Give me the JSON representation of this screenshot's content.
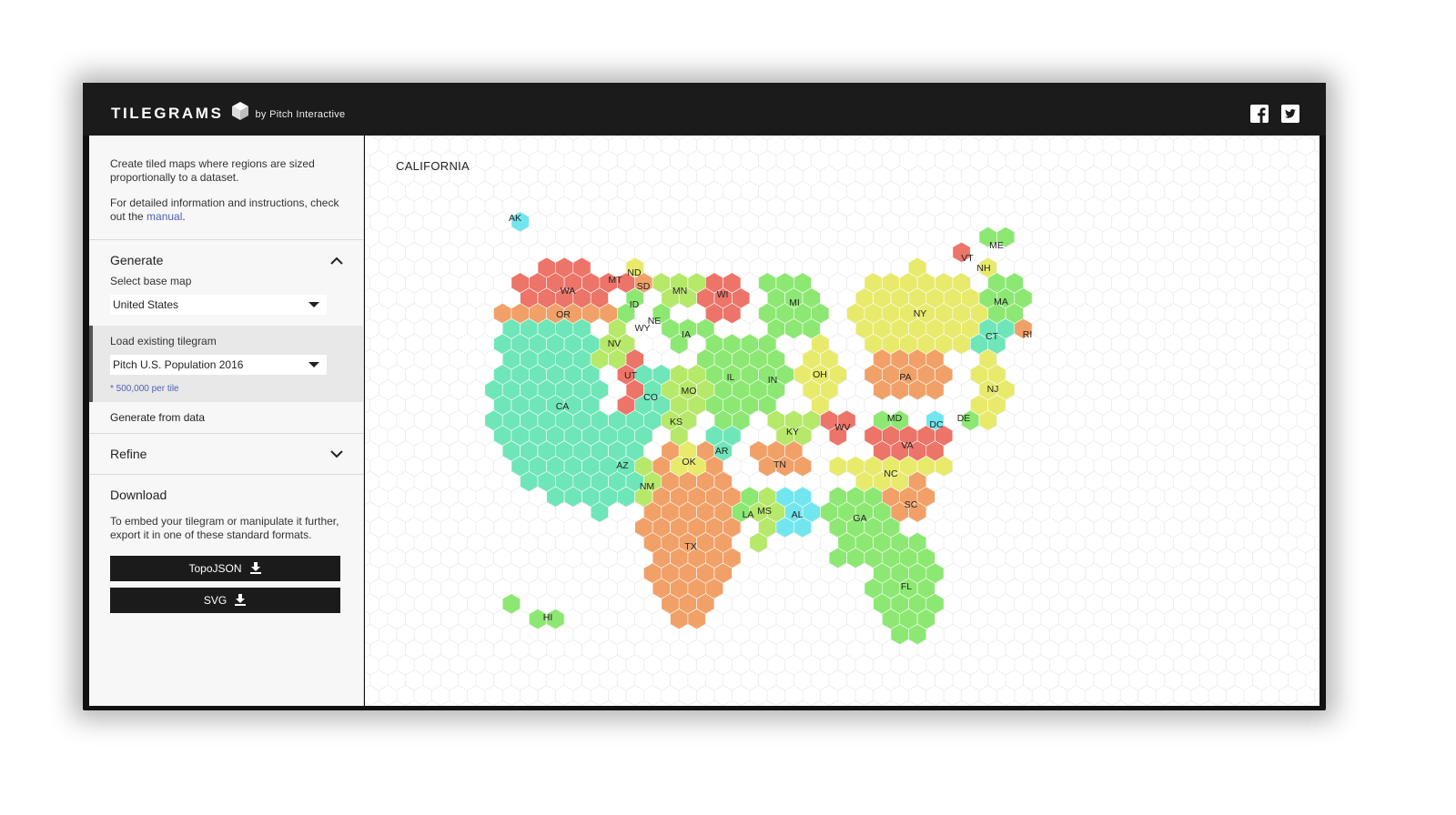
{
  "header": {
    "brand": "TILEGRAMS",
    "by_text": "by Pitch Interactive",
    "social": [
      {
        "name": "facebook-icon"
      },
      {
        "name": "twitter-icon"
      }
    ]
  },
  "sidebar": {
    "intro_1": "Create tiled maps where regions are sized proportionally to a dataset.",
    "intro_2_prefix": "For detailed information and instructions, check out the ",
    "intro_2_link": "manual",
    "intro_2_suffix": ".",
    "generate": {
      "title": "Generate",
      "base_map_label": "Select base map",
      "base_map_value": "United States",
      "load_label": "Load existing tilegram",
      "load_value": "Pitch U.S. Population 2016",
      "note": "* 500,000 per tile",
      "from_data": "Generate from data"
    },
    "refine": {
      "title": "Refine"
    },
    "download": {
      "title": "Download",
      "text": "To embed your tilegram or manipulate it further, export it in one of these standard formats.",
      "topojson_label": "TopoJSON",
      "svg_label": "SVG"
    }
  },
  "map": {
    "selected_title": "CALIFORNIA",
    "colors": {
      "red": "#ec7468",
      "orange": "#f1a168",
      "yellow": "#e8ea6c",
      "lime": "#b6e86a",
      "green": "#8ce872",
      "mint": "#6ee6b8",
      "cyan": "#72e6ee"
    },
    "states": [
      {
        "abbr": "AK",
        "color": "cyan"
      },
      {
        "abbr": "HI",
        "color": "green"
      },
      {
        "abbr": "WA",
        "color": "red"
      },
      {
        "abbr": "OR",
        "color": "orange"
      },
      {
        "abbr": "CA",
        "color": "mint"
      },
      {
        "abbr": "MT",
        "color": "red"
      },
      {
        "abbr": "ID",
        "color": "green"
      },
      {
        "abbr": "NV",
        "color": "lime"
      },
      {
        "abbr": "UT",
        "color": "red"
      },
      {
        "abbr": "WY",
        "color": "cyan"
      },
      {
        "abbr": "ND",
        "color": "yellow"
      },
      {
        "abbr": "SD",
        "color": "orange"
      },
      {
        "abbr": "NE",
        "color": "green"
      },
      {
        "abbr": "CO",
        "color": "mint"
      },
      {
        "abbr": "AZ",
        "color": "mint"
      },
      {
        "abbr": "NM",
        "color": "lime"
      },
      {
        "abbr": "KS",
        "color": "lime"
      },
      {
        "abbr": "OK",
        "color": "yellow"
      },
      {
        "abbr": "TX",
        "color": "orange"
      },
      {
        "abbr": "MN",
        "color": "lime"
      },
      {
        "abbr": "IA",
        "color": "green"
      },
      {
        "abbr": "MO",
        "color": "lime"
      },
      {
        "abbr": "AR",
        "color": "mint"
      },
      {
        "abbr": "LA",
        "color": "green"
      },
      {
        "abbr": "WI",
        "color": "red"
      },
      {
        "abbr": "IL",
        "color": "green"
      },
      {
        "abbr": "MS",
        "color": "lime"
      },
      {
        "abbr": "MI",
        "color": "green"
      },
      {
        "abbr": "IN",
        "color": "green"
      },
      {
        "abbr": "KY",
        "color": "lime"
      },
      {
        "abbr": "TN",
        "color": "orange"
      },
      {
        "abbr": "AL",
        "color": "cyan"
      },
      {
        "abbr": "OH",
        "color": "yellow"
      },
      {
        "abbr": "GA",
        "color": "green"
      },
      {
        "abbr": "FL",
        "color": "green"
      },
      {
        "abbr": "WV",
        "color": "red"
      },
      {
        "abbr": "VA",
        "color": "red"
      },
      {
        "abbr": "NC",
        "color": "yellow"
      },
      {
        "abbr": "SC",
        "color": "orange"
      },
      {
        "abbr": "PA",
        "color": "orange"
      },
      {
        "abbr": "MD",
        "color": "green"
      },
      {
        "abbr": "DC",
        "color": "cyan"
      },
      {
        "abbr": "DE",
        "color": "green"
      },
      {
        "abbr": "NJ",
        "color": "yellow"
      },
      {
        "abbr": "NY",
        "color": "yellow"
      },
      {
        "abbr": "CT",
        "color": "mint"
      },
      {
        "abbr": "RI",
        "color": "orange"
      },
      {
        "abbr": "MA",
        "color": "green"
      },
      {
        "abbr": "VT",
        "color": "red"
      },
      {
        "abbr": "NH",
        "color": "yellow"
      },
      {
        "abbr": "ME",
        "color": "green"
      }
    ]
  }
}
